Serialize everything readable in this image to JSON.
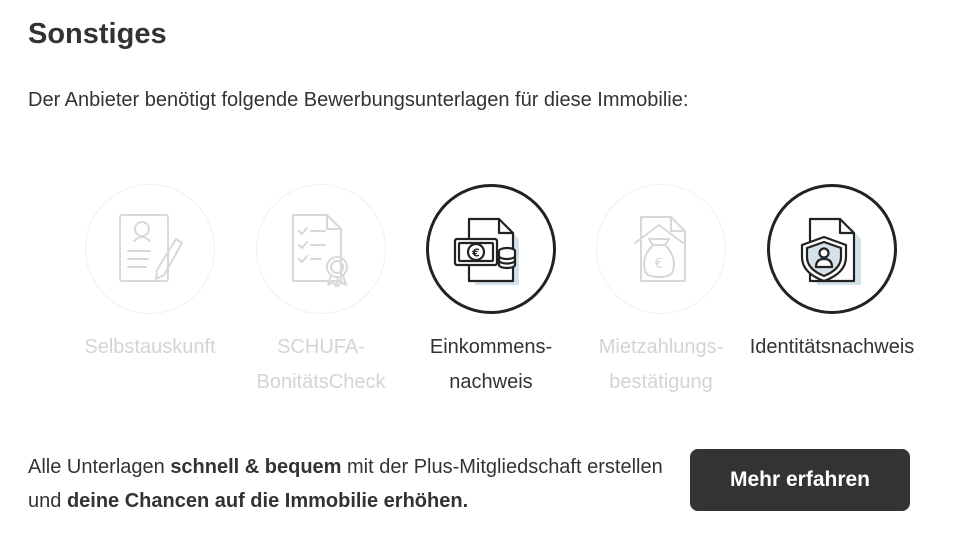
{
  "section": {
    "title": "Sonstiges",
    "intro": "Der Anbieter benötigt folgende Bewerbungsunterlagen für diese Immobilie:"
  },
  "documents": [
    {
      "line1": "Selbstauskunft",
      "line2": "",
      "icon": "self-disclosure-form-icon",
      "required": false
    },
    {
      "line1": "SCHUFA-",
      "line2": "BonitätsCheck",
      "icon": "credit-check-certificate-icon",
      "required": false
    },
    {
      "line1": "Einkommens-",
      "line2": "nachweis",
      "icon": "income-proof-euro-coins-icon",
      "required": true
    },
    {
      "line1": "Mietzahlungs-",
      "line2": "bestätigung",
      "icon": "rent-payment-moneybag-house-icon",
      "required": false
    },
    {
      "line1": "Identitätsnachweis",
      "line2": "",
      "icon": "identity-proof-shield-icon",
      "required": true
    }
  ],
  "promo": {
    "t1": "Alle Unterlagen ",
    "b1": "schnell & bequem",
    "t2": " mit der Plus-Mitgliedschaft erstellen und ",
    "b2": "deine Chancen auf die Immobilie erhöhen."
  },
  "cta": {
    "label": "Mehr erfahren"
  },
  "colors": {
    "text": "#333333",
    "muted": "#d4d4d4",
    "button": "#333333",
    "doc_fill": "#d3e2ea"
  }
}
